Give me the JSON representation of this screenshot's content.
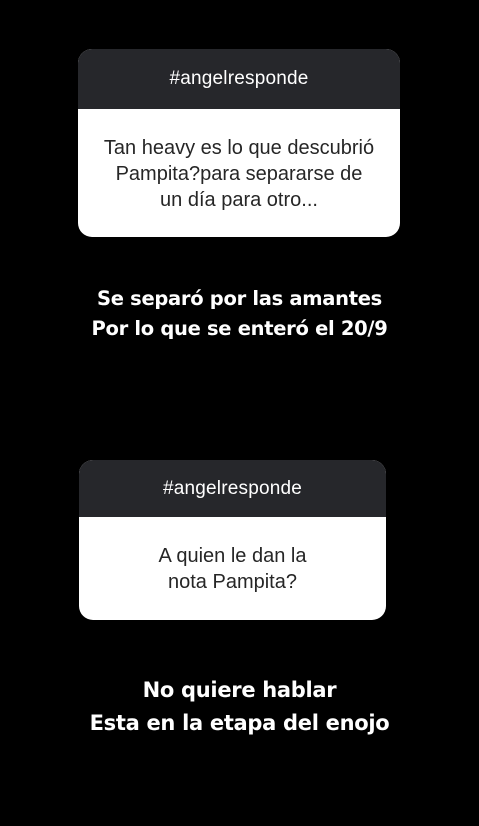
{
  "colors": {
    "background": "#000000",
    "header_bg": "#26272b",
    "card_bg": "#ffffff",
    "question_text": "#262626",
    "answer_text": "#ffffff"
  },
  "questions": [
    {
      "tag": "#angelresponde",
      "lines": [
        "Tan heavy es lo que descubrió",
        "Pampita?para separarse de",
        "un día para otro..."
      ]
    },
    {
      "tag": "#angelresponde",
      "lines": [
        "A quien le dan la",
        "nota Pampita?"
      ]
    }
  ],
  "answers": [
    {
      "lines": [
        "Se separó por las amantes",
        "Por lo que se enteró el 20/9"
      ]
    },
    {
      "lines": [
        "No quiere hablar",
        "Esta en la etapa del enojo"
      ]
    }
  ]
}
